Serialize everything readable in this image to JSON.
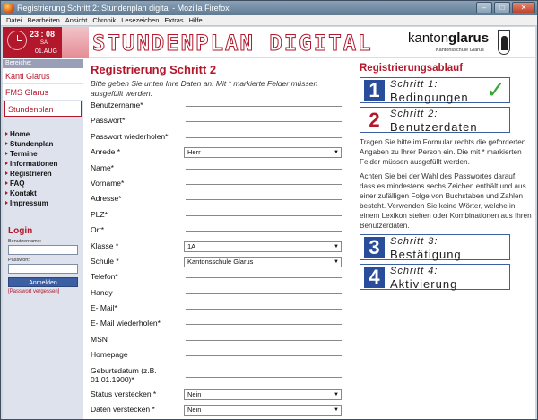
{
  "window": {
    "title": "Registrierung Schritt 2: Stundenplan digital - Mozilla Firefox"
  },
  "menu": [
    "Datei",
    "Bearbeiten",
    "Ansicht",
    "Chronik",
    "Lesezeichen",
    "Extras",
    "Hilfe"
  ],
  "header": {
    "time": "23 : 08",
    "day": "SA",
    "date": "01.AUG",
    "banner": "STUNDENPLAN DIGITAL",
    "kanton_a": "kanton",
    "kanton_b": "glarus",
    "kanton_sub": "Kantonsschule Glarus"
  },
  "sidebar": {
    "heading": "Bereiche:",
    "links": [
      "Kanti Glarus",
      "FMS Glarus",
      "Stundenplan"
    ],
    "nav": [
      "Home",
      "Stundenplan",
      "Termine",
      "Informationen",
      "Registrieren",
      "FAQ",
      "Kontakt",
      "Impressum"
    ],
    "login": {
      "title": "Login",
      "user_label": "Benutzername:",
      "pass_label": "Passwort:",
      "button": "Anmelden",
      "forgot": "[Passwort vergessen]"
    }
  },
  "main": {
    "title": "Registrierung Schritt 2",
    "intro": "Bitte geben Sie unten Ihre Daten an. Mit * markierte Felder müssen ausgefüllt werden.",
    "fields": [
      {
        "label": "Benutzername*"
      },
      {
        "label": "Passwort*"
      },
      {
        "label": "Passwort wiederholen*"
      },
      {
        "label": "Anrede *",
        "select": "Herr"
      },
      {
        "label": "Name*"
      },
      {
        "label": "Vorname*"
      },
      {
        "label": "Adresse*"
      },
      {
        "label": "PLZ*"
      },
      {
        "label": "Ort*"
      },
      {
        "label": "Klasse *",
        "select": "1A"
      },
      {
        "label": "Schule *",
        "select": "Kantonsschule Glarus"
      },
      {
        "label": "Telefon*"
      },
      {
        "label": "Handy"
      },
      {
        "label": "E- Mail*"
      },
      {
        "label": "E- Mail wiederholen*"
      },
      {
        "label": "MSN"
      },
      {
        "label": "Homepage"
      },
      {
        "label": "Geburtsdatum (z.B. 01.01.1900)*",
        "tall": true
      },
      {
        "label": "Status verstecken *",
        "select": "Nein"
      },
      {
        "label": "Daten verstecken *",
        "select": "Nein"
      }
    ]
  },
  "right": {
    "title": "Registrierungsablauf",
    "steps": [
      {
        "num": "1",
        "t1": "Schritt 1:",
        "t2": "Bedingungen"
      },
      {
        "num": "2",
        "t1": "Schritt 2:",
        "t2": "Benutzerdaten"
      },
      {
        "num": "3",
        "t1": "Schritt 3:",
        "t2": "Bestätigung"
      },
      {
        "num": "4",
        "t1": "Schritt 4:",
        "t2": "Aktivierung"
      }
    ],
    "text1": "Tragen Sie bitte im Formular rechts die geforderten Angaben zu Ihrer Person ein. Die mit * markierten Felder müssen ausgefüllt werden.",
    "text2": "Achten Sie bei der Wahl des Passwortes darauf, dass es mindestens sechs Zeichen enthält und aus einer zufälligen Folge von Buchstaben und Zahlen besteht. Verwenden Sie keine Wörter, welche in einem Lexikon stehen oder Kombinationen aus Ihren Benutzerdaten."
  }
}
